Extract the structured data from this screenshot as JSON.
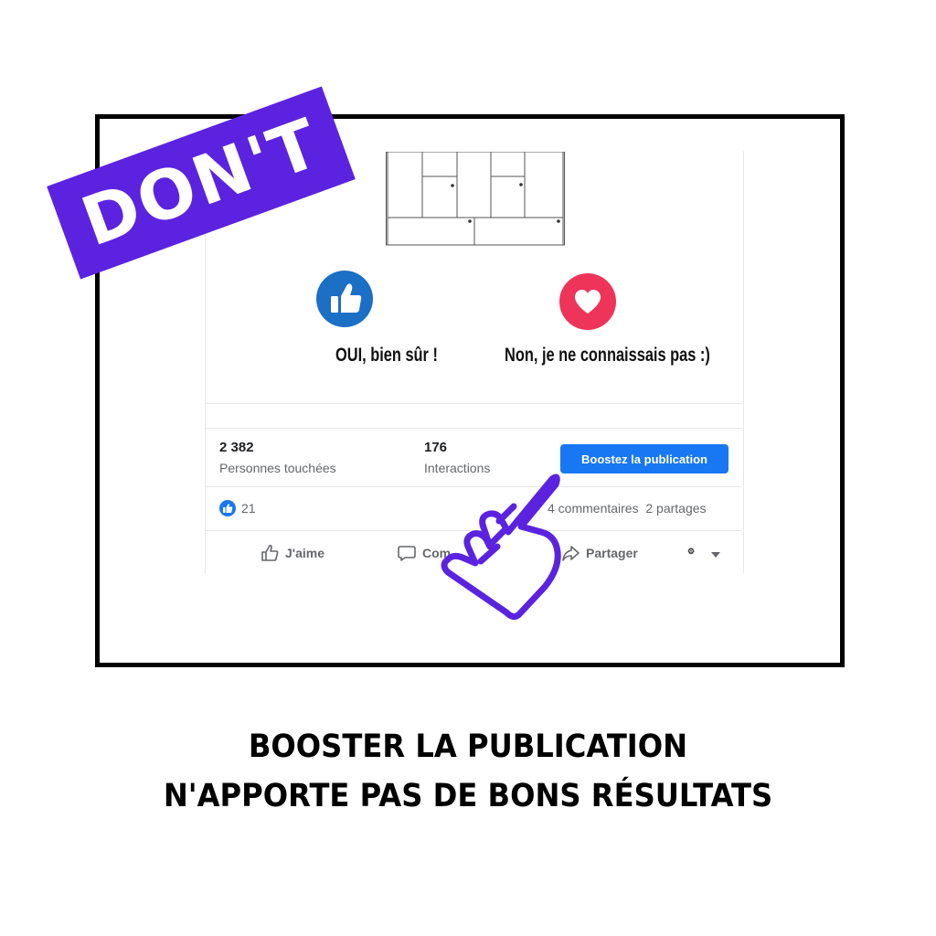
{
  "banner": {
    "label": "DON'T",
    "color": "#5b23e0"
  },
  "post": {
    "options": [
      {
        "icon": "thumbs-up-icon",
        "label": "OUI, bien sûr !"
      },
      {
        "icon": "heart-icon",
        "label": "Non, je ne connaissais pas :)"
      }
    ],
    "stats": {
      "reach_value": "2 382",
      "reach_label": "Personnes touchées",
      "interactions_value": "176",
      "interactions_label": "Interactions"
    },
    "boost_button": "Boostez la publication",
    "reactions_count": "21",
    "comments_shares": "4 commentaires  2 partages",
    "actions": {
      "like": "J'aime",
      "comment": "Com",
      "share": "Partager"
    }
  },
  "caption": {
    "line1": "BOOSTER LA PUBLICATION",
    "line2": "N'APPORTE PAS DE BONS RÉSULTATS"
  },
  "colors": {
    "boost": "#1877f2",
    "like": "#1b6fc5",
    "love": "#ee3559",
    "pointer": "#5b23e0"
  }
}
